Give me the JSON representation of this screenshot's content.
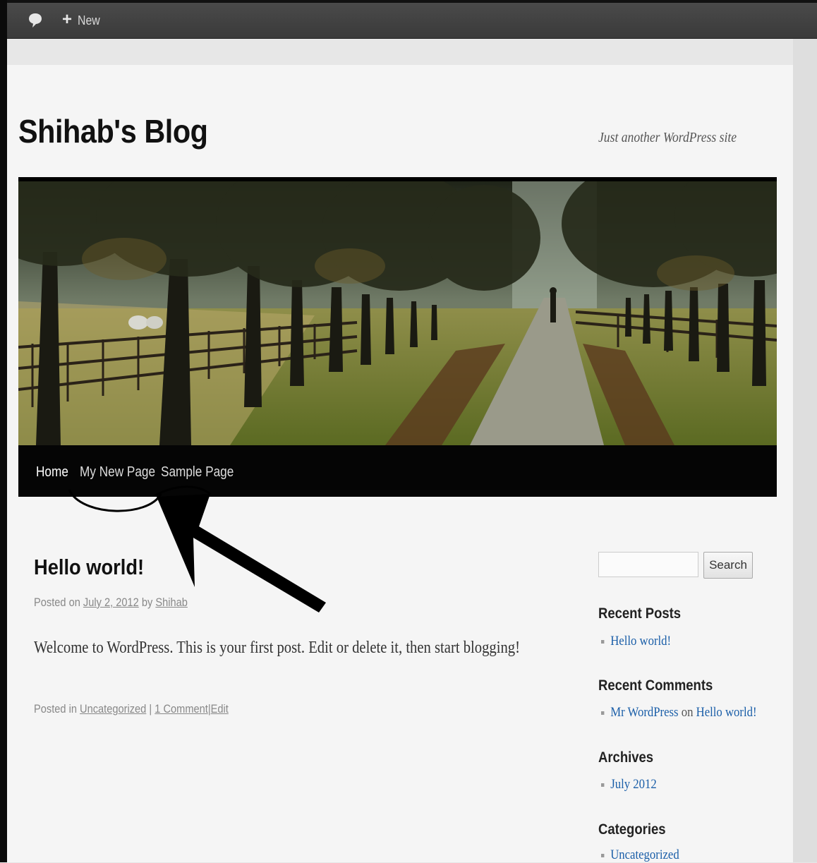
{
  "admin_bar": {
    "comment_icon": "speech-bubble-icon",
    "new_icon": "plus-icon",
    "new_label": "New"
  },
  "site": {
    "title": "Shihab's Blog",
    "tagline": "Just another WordPress site"
  },
  "nav": {
    "items": [
      "Home",
      "My New Page",
      "Sample Page"
    ],
    "current": "Home"
  },
  "post": {
    "title": "Hello world!",
    "meta_prefix": "Posted on",
    "date": "July 2, 2012",
    "meta_by": "by",
    "author": "Shihab",
    "content": "Welcome to WordPress. This is your first post. Edit or delete it, then start blogging!",
    "footer_prefix": "Posted in",
    "category": "Uncategorized",
    "separator": "|",
    "comments": "1 Comment",
    "edit": "Edit"
  },
  "sidebar": {
    "search_button": "Search",
    "search_value": "",
    "recent_posts_title": "Recent Posts",
    "recent_posts": [
      "Hello world!"
    ],
    "recent_comments_title": "Recent Comments",
    "recent_comment": {
      "author": "Mr WordPress",
      "on": "on",
      "post": "Hello world!"
    },
    "archives_title": "Archives",
    "archives": [
      "July 2012"
    ],
    "categories_title": "Categories",
    "categories": [
      "Uncategorized"
    ]
  },
  "colors": {
    "nav_bg": "#050505",
    "link": "#1a5ea8",
    "admin_bar": "#464646",
    "page_bg": "#f5f5f5"
  }
}
